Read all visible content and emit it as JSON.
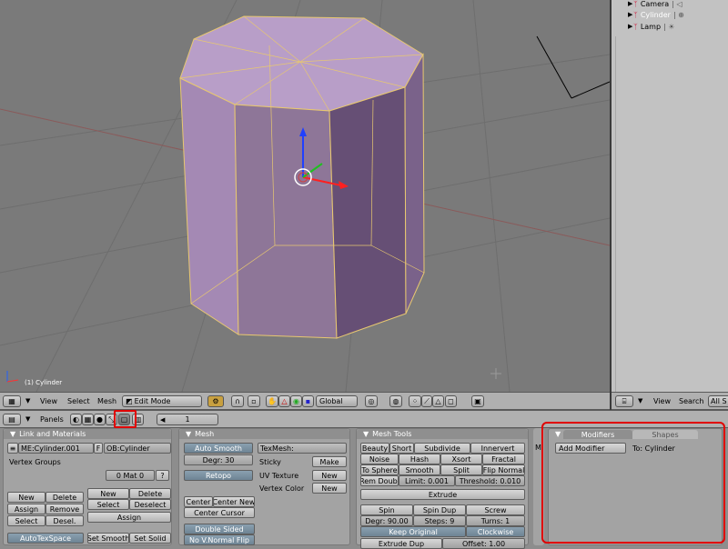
{
  "viewport": {
    "object_label": "(1) Cylinder"
  },
  "outliner": {
    "items": [
      {
        "label": "Camera"
      },
      {
        "label": "Cylinder"
      },
      {
        "label": "Lamp"
      }
    ]
  },
  "viewport_header": {
    "menus": [
      "View",
      "Select",
      "Mesh"
    ],
    "mode": "Edit Mode",
    "orientation": "Global"
  },
  "outliner_header": {
    "menus": [
      "View",
      "Search"
    ],
    "search_value": "All S"
  },
  "buttons_header": {
    "panels_label": "Panels",
    "frame": "1"
  },
  "panel_link_materials": {
    "title": "Link and Materials",
    "mesh_name": "ME:Cylinder.001",
    "fake_user": "F",
    "object_name": "OB:Cylinder",
    "vertex_groups_label": "Vertex Groups",
    "mat_index": "0 Mat 0",
    "mat_question": "?",
    "vg_new": "New",
    "vg_delete": "Delete",
    "vg_assign": "Assign",
    "vg_remove": "Remove",
    "vg_select": "Select",
    "vg_desel": "Desel.",
    "mat_new": "New",
    "mat_delete": "Delete",
    "mat_select": "Select",
    "mat_deselect": "Deselect",
    "mat_assign": "Assign",
    "autotexspace": "AutoTexSpace",
    "set_smooth": "Set Smooth",
    "set_solid": "Set Solid"
  },
  "panel_mesh": {
    "title": "Mesh",
    "auto_smooth": "Auto Smooth",
    "degr": "Degr: 30",
    "retopo": "Retopo",
    "texmesh": "TexMesh:",
    "sticky": "Sticky",
    "make": "Make",
    "uv_texture": "UV Texture",
    "uv_new": "New",
    "vertex_color": "Vertex Color",
    "vc_new": "New",
    "center": "Center",
    "center_new": "Center New",
    "center_cursor": "Center Cursor",
    "double_sided": "Double Sided",
    "no_vnormal_flip": "No V.Normal Flip"
  },
  "panel_mesh_tools": {
    "title": "Mesh Tools",
    "beauty": "Beauty",
    "short": "Short",
    "subdivide": "Subdivide",
    "innervert": "Innervert",
    "noise": "Noise",
    "hash": "Hash",
    "xsort": "Xsort",
    "fractal": "Fractal",
    "to_sphere": "To Sphere",
    "smooth": "Smooth",
    "split": "Split",
    "flip_normal": "Flip Normal",
    "rem_doubl": "Rem Doubl",
    "limit": "Limit: 0.001",
    "threshold": "Threshold: 0.010",
    "extrude": "Extrude",
    "spin": "Spin",
    "spin_dup": "Spin Dup",
    "screw": "Screw",
    "degr": "Degr: 90.00",
    "steps": "Steps: 9",
    "turns": "Turns: 1",
    "keep_original": "Keep Original",
    "clockwise": "Clockwise",
    "extrude_dup": "Extrude Dup",
    "offset": "Offset: 1.00"
  },
  "panel_modifiers": {
    "tab_modifiers": "Modifiers",
    "tab_shapes": "Shapes",
    "add_modifier": "Add Modifier",
    "to_label": "To: Cylinder",
    "side_letter": "M"
  }
}
